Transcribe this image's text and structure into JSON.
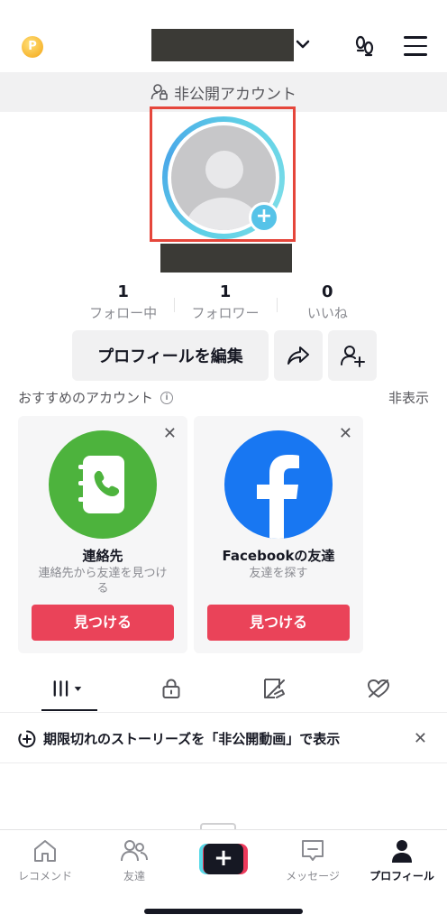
{
  "header": {
    "coin_glyph": "P",
    "chevron": "⌄"
  },
  "private_bar": {
    "label": "非公開アカウント"
  },
  "avatar": {
    "add_glyph": "+"
  },
  "stats": [
    {
      "value": "1",
      "label": "フォロー中"
    },
    {
      "value": "1",
      "label": "フォロワー"
    },
    {
      "value": "0",
      "label": "いいね"
    }
  ],
  "actions": {
    "edit_profile": "プロフィールを編集"
  },
  "suggested": {
    "title": "おすすめのアカウント",
    "info_glyph": "i",
    "hide": "非表示",
    "cards": [
      {
        "name": "連絡先",
        "desc": "連絡先から友達を見つける",
        "button": "見つける",
        "close": "✕",
        "icon": "contacts-book-icon",
        "color": "#4db33d"
      },
      {
        "name": "Facebookの友達",
        "desc": "友達を探す",
        "button": "見つける",
        "close": "✕",
        "icon": "facebook-icon",
        "color": "#1877f2"
      }
    ]
  },
  "tabs": [
    {
      "icon": "grid-icon",
      "active": true
    },
    {
      "icon": "lock-icon"
    },
    {
      "icon": "tagged-icon"
    },
    {
      "icon": "liked-icon"
    }
  ],
  "banner": {
    "text": "期限切れのストーリーズを「非公開動画」で表示",
    "close": "✕"
  },
  "bottom_nav": [
    {
      "label": "レコメンド",
      "icon": "home-icon"
    },
    {
      "label": "友達",
      "icon": "friends-icon"
    },
    {
      "label": "",
      "icon": "create-plus-icon",
      "glyph": "+"
    },
    {
      "label": "メッセージ",
      "icon": "inbox-icon"
    },
    {
      "label": "プロフィール",
      "icon": "profile-icon",
      "active": true
    }
  ],
  "colors": {
    "accent_red": "#ea4359",
    "avatar_ring": "#56c3e8",
    "highlight_frame": "#e5463b"
  }
}
